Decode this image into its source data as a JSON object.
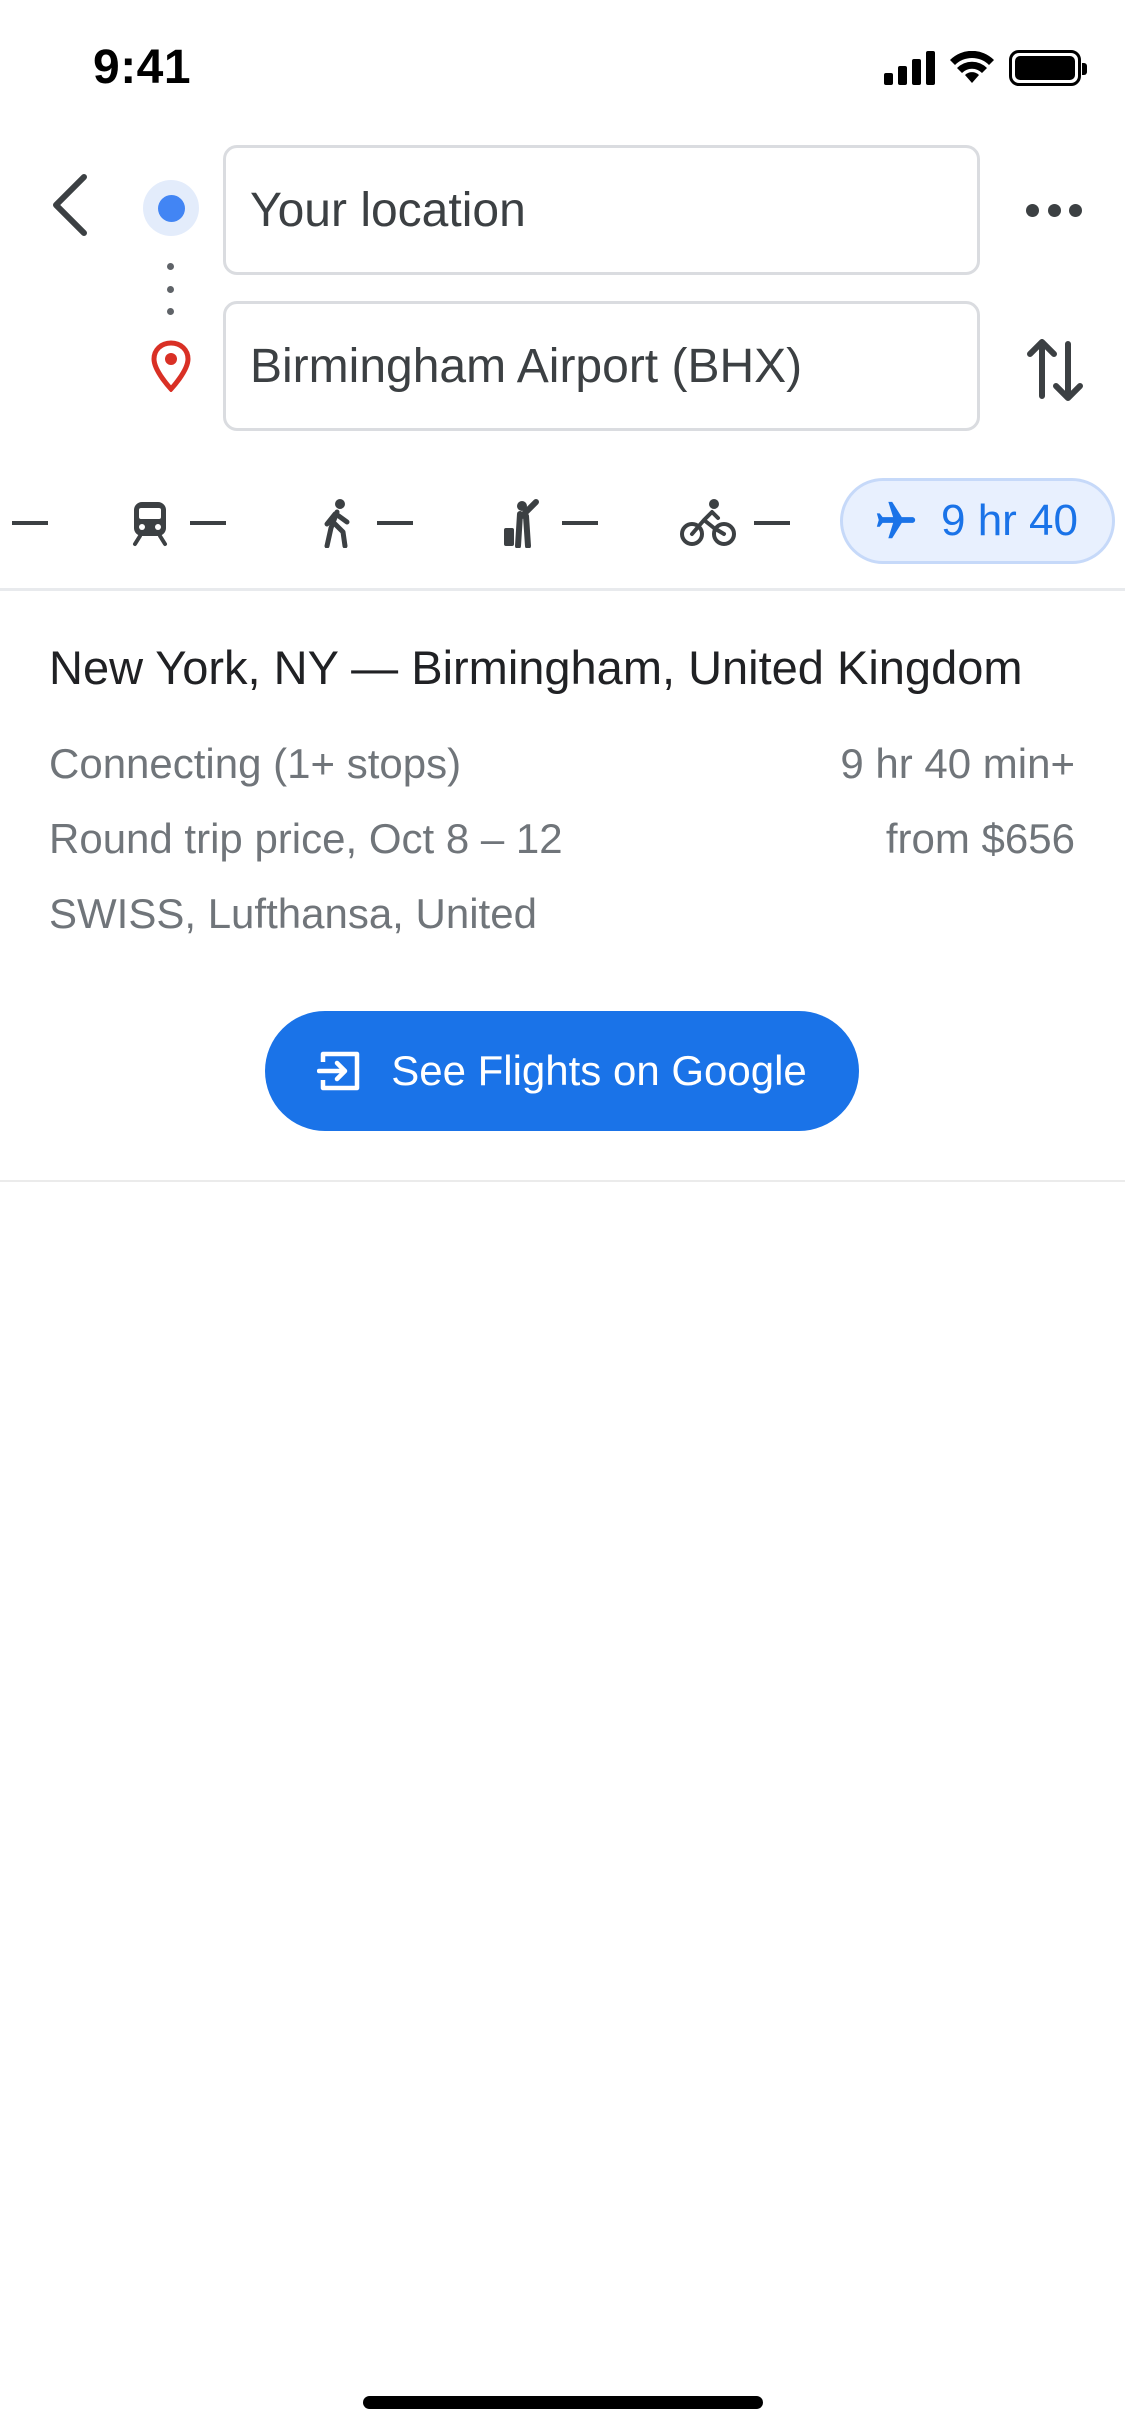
{
  "status_bar": {
    "time": "9:41"
  },
  "directions": {
    "origin_value": "Your location",
    "destination_value": "Birmingham Airport (BHX)"
  },
  "travel_modes": {
    "driving": "—",
    "transit": "—",
    "walking": "—",
    "ride_hailing": "—",
    "cycling": "—",
    "flights": "9 hr 40",
    "selected": "flights"
  },
  "flight_card": {
    "route": "New York, NY — Birmingham, United Kingdom",
    "stops": "Connecting (1+ stops)",
    "duration": "9 hr 40 min+",
    "price_label": "Round trip price, Oct 8 – 12",
    "price": "from $656",
    "airlines": "SWISS, Lufthansa, United",
    "cta_label": "See Flights on Google"
  },
  "colors": {
    "accent": "#1a73e8",
    "origin_dot": "#4285f4",
    "destination_pin": "#d93025",
    "secondary_text": "#70757a"
  }
}
